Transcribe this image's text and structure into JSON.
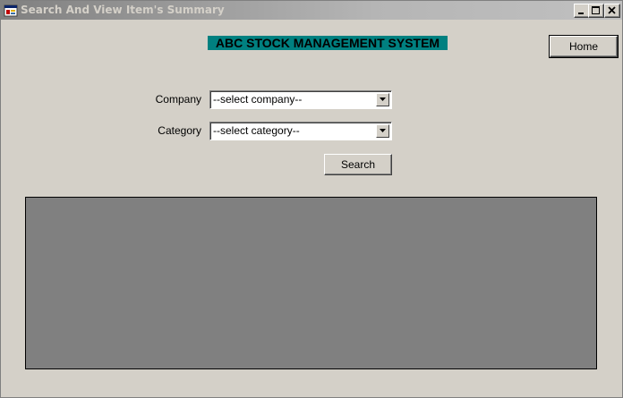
{
  "window": {
    "title": "Search And View Item's Summary",
    "icons": [
      "app-form-icon",
      "minimize-icon",
      "maximize-icon",
      "close-icon"
    ]
  },
  "banner": {
    "text": "ABC STOCK MANAGEMENT SYSTEM",
    "background": "#008080"
  },
  "buttons": {
    "home_label": "Home",
    "search_label": "Search"
  },
  "form": {
    "company_label": "Company",
    "company_value": "--select company--",
    "category_label": "Category",
    "category_value": "--select category--"
  },
  "results_grid": {
    "background": "#808080"
  }
}
